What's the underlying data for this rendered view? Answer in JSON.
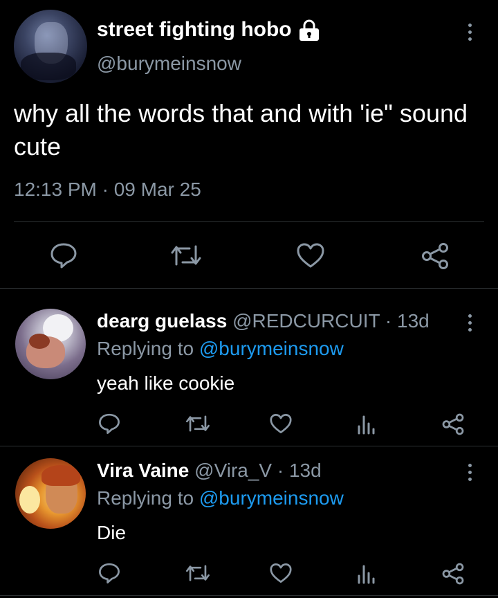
{
  "main_tweet": {
    "author_name": "street fighting hobo",
    "author_handle": "@burymeinsnow",
    "text": "why all the words that and with 'ie\" sound cute",
    "timestamp": "12:13 PM · 09 Mar 25"
  },
  "replies": [
    {
      "author_name": "dearg guelass",
      "author_handle": "@REDCURCUIT · 13d",
      "replying_prefix": "Replying to ",
      "replying_to": "@burymeinsnow",
      "text": "yeah like cookie"
    },
    {
      "author_name": "Vira Vaine",
      "author_handle": "@Vira_V · 13d",
      "replying_prefix": "Replying to ",
      "replying_to": "@burymeinsnow",
      "text": "Die"
    }
  ],
  "icons": [
    "lock-icon",
    "more-icon",
    "reply-icon",
    "retweet-icon",
    "like-icon",
    "views-icon",
    "share-icon"
  ],
  "colors": {
    "background": "#000000",
    "text": "#e7e9ea",
    "muted": "#8b98a5",
    "link": "#1d9bf0",
    "divider": "#2f3336"
  }
}
